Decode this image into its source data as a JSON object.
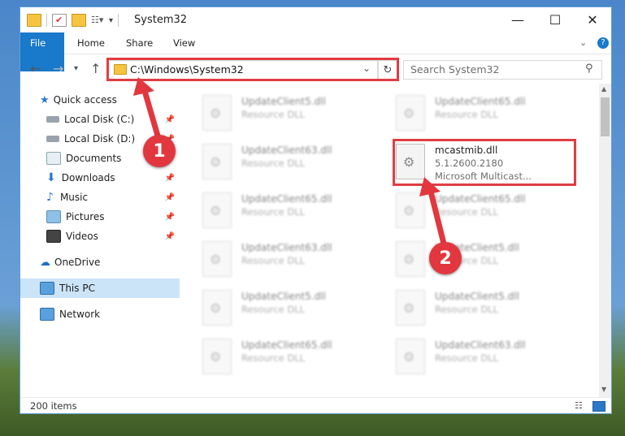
{
  "window": {
    "title": "System32"
  },
  "ribbon": {
    "tabs": [
      "File",
      "Home",
      "Share",
      "View"
    ]
  },
  "address": {
    "path": "C:\\Windows\\System32"
  },
  "search": {
    "placeholder": "Search System32"
  },
  "nav": {
    "items": [
      {
        "label": "Quick access",
        "icon": "star-icon",
        "pinned": false
      },
      {
        "label": "Local Disk (C:)",
        "icon": "drive-icon",
        "pinned": true
      },
      {
        "label": "Local Disk (D:)",
        "icon": "drive-icon",
        "pinned": true
      },
      {
        "label": "Documents",
        "icon": "documents-icon",
        "pinned": true
      },
      {
        "label": "Downloads",
        "icon": "download-icon",
        "pinned": true
      },
      {
        "label": "Music",
        "icon": "music-icon",
        "pinned": true
      },
      {
        "label": "Pictures",
        "icon": "pictures-icon",
        "pinned": true
      },
      {
        "label": "Videos",
        "icon": "videos-icon",
        "pinned": true
      },
      {
        "label": "OneDrive",
        "icon": "cloud-icon",
        "pinned": false
      },
      {
        "label": "This PC",
        "icon": "computer-icon",
        "pinned": false,
        "selected": true
      },
      {
        "label": "Network",
        "icon": "network-icon",
        "pinned": false
      }
    ]
  },
  "files": {
    "left": [
      {
        "name": "UpdateClient5.dll",
        "meta": "Resource DLL"
      },
      {
        "name": "UpdateClient63.dll",
        "meta": "Resource DLL"
      },
      {
        "name": "UpdateClient65.dll",
        "meta": "Resource DLL"
      },
      {
        "name": "UpdateClient63.dll",
        "meta": "Resource DLL"
      },
      {
        "name": "UpdateClient5.dll",
        "meta": "Resource DLL"
      },
      {
        "name": "UpdateClient65.dll",
        "meta": "Resource DLL"
      }
    ],
    "right": [
      {
        "name": "UpdateClient65.dll",
        "meta": "Resource DLL"
      },
      {
        "name": "UpdateClient65.dll",
        "meta": "Resource DLL"
      },
      {
        "name": "UpdateClient5.dll",
        "meta": "Resource DLL"
      },
      {
        "name": "UpdateClient5.dll",
        "meta": "Resource DLL"
      },
      {
        "name": "UpdateClient63.dll",
        "meta": "Resource DLL"
      }
    ],
    "highlighted": {
      "name": "mcastmib.dll",
      "version": "5.1.2600.2180",
      "description": "Microsoft Multicast..."
    }
  },
  "status": {
    "count": "200 items"
  },
  "annotations": {
    "step1": "1",
    "step2": "2",
    "color": "#e2373e"
  }
}
